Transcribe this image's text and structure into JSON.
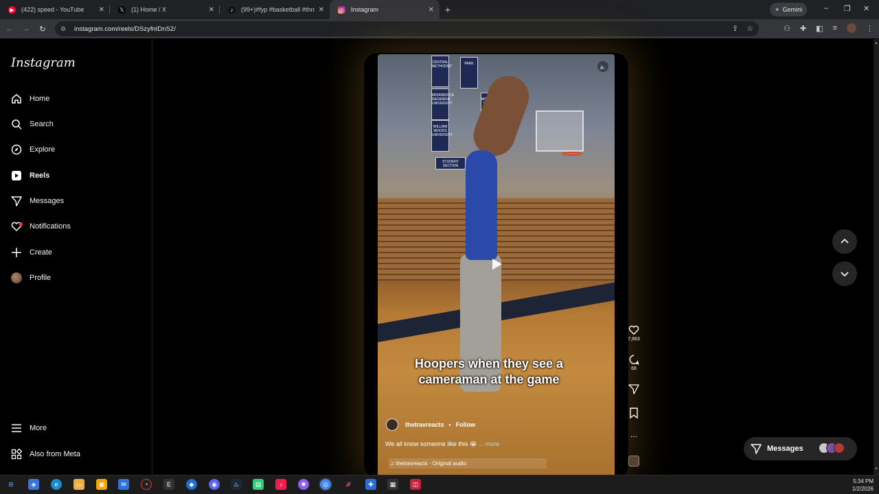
{
  "browser": {
    "tabs": [
      {
        "label": "(422) speed - YouTube",
        "icon": "youtube-icon",
        "color": "#ff0033"
      },
      {
        "label": "(1) Home / X",
        "icon": "x-icon",
        "color": "#000000"
      },
      {
        "label": "(99+)#fyp #basketball #throwb",
        "icon": "tiktok-icon",
        "color": "#111111"
      },
      {
        "label": "Instagram",
        "icon": "instagram-icon",
        "color": "#d62976"
      }
    ],
    "new_tab": "+",
    "gemini_label": "Gemini",
    "url": "instagram.com/reels/DSzyfnIDnS2/"
  },
  "sidebar": {
    "logo": "Instagram",
    "items": [
      {
        "label": "Home",
        "icon": "home-icon"
      },
      {
        "label": "Search",
        "icon": "search-icon"
      },
      {
        "label": "Explore",
        "icon": "compass-icon"
      },
      {
        "label": "Reels",
        "icon": "reels-icon"
      },
      {
        "label": "Messages",
        "icon": "messenger-icon"
      },
      {
        "label": "Notifications",
        "icon": "heart-icon"
      },
      {
        "label": "Create",
        "icon": "plus-icon"
      },
      {
        "label": "Profile",
        "icon": "profile-avatar"
      }
    ],
    "more": "More",
    "also_from_meta": "Also from Meta"
  },
  "reel": {
    "caption": "Hoopers when they see a cameraman at the game",
    "author": "thetravreacts",
    "follow": "Follow",
    "description": "We all know someone like this 😭",
    "more": "... more",
    "audio": "thetravreacts · Original audio",
    "banners": [
      "CENTRAL METHODIST",
      "PARK",
      "MIDAMERICA NAZARENE UNIVERSITY",
      "MISSOURI VALLEY",
      "WILLIAM WOODS UNIVERSITY",
      "STUDENT SECTION"
    ]
  },
  "actions": {
    "likes": "7,663",
    "comments": "66",
    "more": "..."
  },
  "messages_pill": {
    "label": "Messages"
  },
  "taskbar": {
    "time": "5:34 PM",
    "date": "1/2/2026"
  }
}
